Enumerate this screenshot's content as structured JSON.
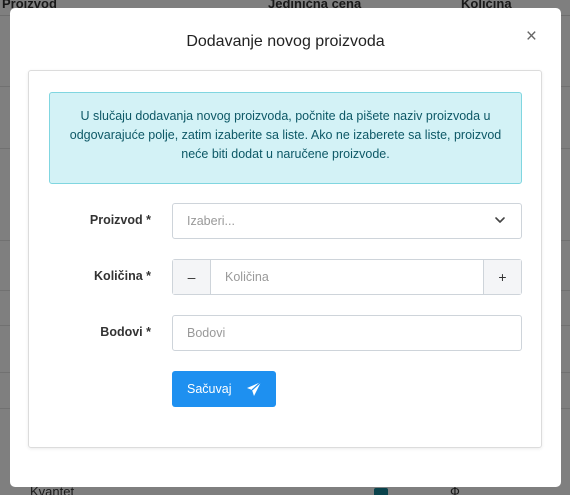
{
  "background": {
    "columns": [
      "Proizvod",
      "Jedinična cena",
      "Količina"
    ],
    "footer_left": "Kvantet",
    "footer_right": "Ф"
  },
  "modal": {
    "title": "Dodavanje novog proizvoda",
    "close_symbol": "×",
    "info_text": "U slučaju dodavanja novog proizvoda, počnite da pišete naziv proizvoda u odgovarajuće polje, zatim izaberite sa liste. Ako ne izaberete sa liste, proizvod neće biti dodat u naručene proizvode.",
    "product": {
      "label": "Proizvod *",
      "placeholder": "Izaberi..."
    },
    "quantity": {
      "label": "Količina *",
      "placeholder": "Količina",
      "minus": "–",
      "plus": "+"
    },
    "points": {
      "label": "Bodovi *",
      "placeholder": "Bodovi"
    },
    "save_label": "Sačuvaj"
  },
  "colors": {
    "primary": "#1e90f0",
    "info_bg": "#d3f2f6",
    "info_border": "#80d6e0",
    "info_text": "#0d5866"
  },
  "icons": {
    "close": "close-icon",
    "dropdown": "chevron-down-icon",
    "save": "paper-plane-icon"
  }
}
